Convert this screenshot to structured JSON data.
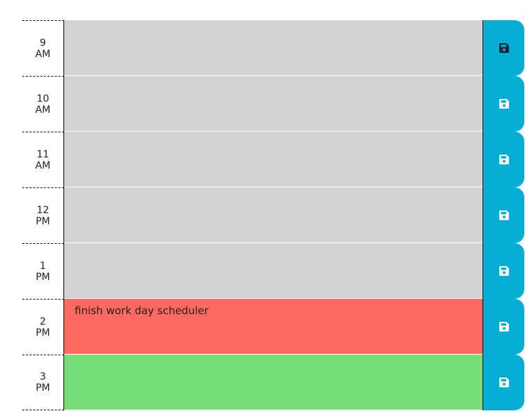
{
  "colors": {
    "past": "#d3d3d3",
    "present": "#ff6961",
    "future": "#77dd77",
    "save_button": "#06aed5",
    "icon_default": "#ffffff",
    "icon_active": "#1b2838"
  },
  "time_blocks": [
    {
      "hour": "9",
      "period": "AM",
      "status": "past",
      "text": "",
      "icon": "floppy-disk-icon",
      "icon_active": true
    },
    {
      "hour": "10",
      "period": "AM",
      "status": "past",
      "text": "",
      "icon": "floppy-disk-icon",
      "icon_active": false
    },
    {
      "hour": "11",
      "period": "AM",
      "status": "past",
      "text": "",
      "icon": "floppy-disk-icon",
      "icon_active": false
    },
    {
      "hour": "12",
      "period": "PM",
      "status": "past",
      "text": "",
      "icon": "floppy-disk-icon",
      "icon_active": false
    },
    {
      "hour": "1",
      "period": "PM",
      "status": "past",
      "text": "",
      "icon": "floppy-disk-icon",
      "icon_active": false
    },
    {
      "hour": "2",
      "period": "PM",
      "status": "present",
      "text": "finish work day scheduler",
      "icon": "floppy-disk-icon",
      "icon_active": false
    },
    {
      "hour": "3",
      "period": "PM",
      "status": "future",
      "text": "",
      "icon": "floppy-disk-icon",
      "icon_active": false
    }
  ]
}
